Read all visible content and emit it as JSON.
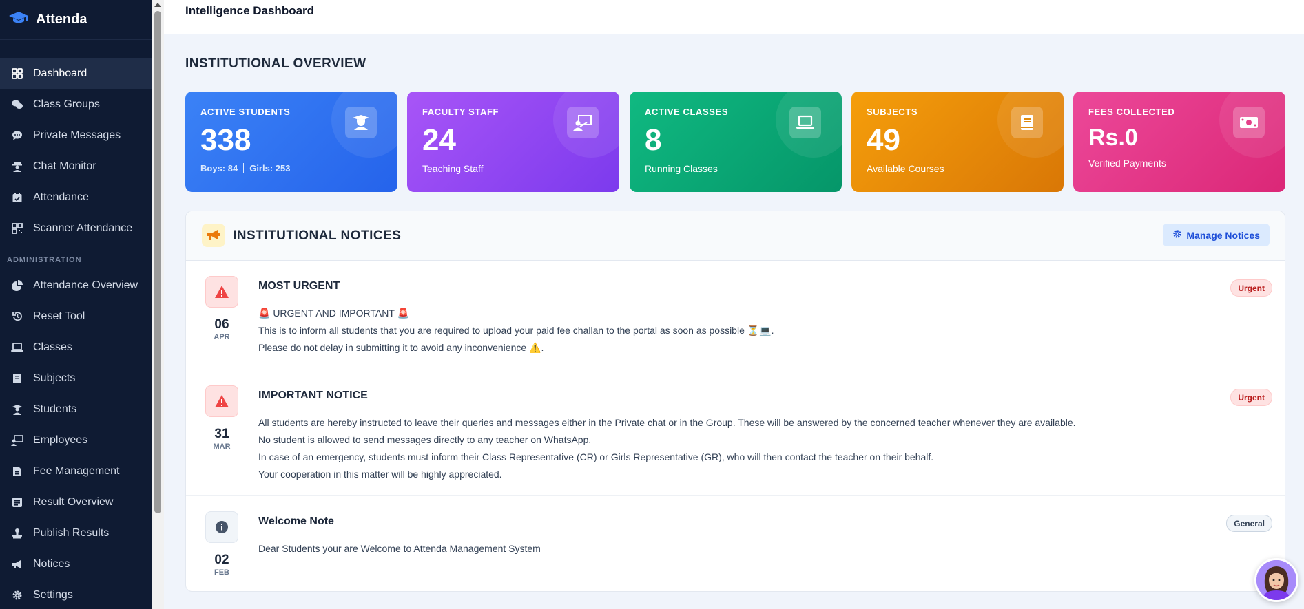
{
  "app": {
    "name": "Attenda"
  },
  "header": {
    "title": "Intelligence Dashboard"
  },
  "sidebar": {
    "items": [
      {
        "label": "Dashboard"
      },
      {
        "label": "Class Groups"
      },
      {
        "label": "Private Messages"
      },
      {
        "label": "Chat Monitor"
      },
      {
        "label": "Attendance"
      },
      {
        "label": "Scanner Attendance"
      }
    ],
    "admin_label": "ADMINISTRATION",
    "admin_items": [
      {
        "label": "Attendance Overview"
      },
      {
        "label": "Reset Tool"
      },
      {
        "label": "Classes"
      },
      {
        "label": "Subjects"
      },
      {
        "label": "Students"
      },
      {
        "label": "Employees"
      },
      {
        "label": "Fee Management"
      },
      {
        "label": "Result Overview"
      },
      {
        "label": "Publish Results"
      },
      {
        "label": "Notices"
      },
      {
        "label": "Settings"
      }
    ]
  },
  "overview": {
    "title": "INSTITUTIONAL OVERVIEW",
    "cards": [
      {
        "label": "ACTIVE STUDENTS",
        "value": "338",
        "boys": "Boys: 84",
        "girls": "Girls: 253",
        "icon": "graduate-icon"
      },
      {
        "label": "FACULTY STAFF",
        "value": "24",
        "sub": "Teaching Staff",
        "icon": "teacher-board-icon"
      },
      {
        "label": "ACTIVE CLASSES",
        "value": "8",
        "sub": "Running Classes",
        "icon": "laptop-icon"
      },
      {
        "label": "SUBJECTS",
        "value": "49",
        "sub": "Available Courses",
        "icon": "book-icon"
      },
      {
        "label": "FEES COLLECTED",
        "value": "Rs.0",
        "sub": "Verified Payments",
        "icon": "money-icon"
      }
    ]
  },
  "notices": {
    "title": "INSTITUTIONAL NOTICES",
    "manage_label": "Manage Notices",
    "items": [
      {
        "day": "06",
        "month": "APR",
        "title": "MOST URGENT",
        "badge": "Urgent",
        "lines": [
          "🚨 URGENT AND IMPORTANT 🚨",
          "This is to inform all students that you are required to upload your paid fee challan to the portal as soon as possible ⏳💻.",
          "Please do not delay in submitting it to avoid any inconvenience ⚠️."
        ]
      },
      {
        "day": "31",
        "month": "MAR",
        "title": "IMPORTANT NOTICE",
        "badge": "Urgent",
        "lines": [
          "All students are hereby instructed to leave their queries and messages either in the Private chat or in the Group. These will be answered by the concerned teacher whenever they are available.",
          "No student is allowed to send messages directly to any teacher on WhatsApp.",
          "In case of an emergency, students must inform their Class Representative (CR) or Girls Representative (GR), who will then contact the teacher on their behalf.",
          "Your cooperation in this matter will be highly appreciated."
        ]
      },
      {
        "day": "02",
        "month": "FEB",
        "title": "Welcome Note",
        "badge": "General",
        "lines": [
          "Dear Students your are Welcome to Attenda Management System"
        ]
      }
    ]
  },
  "colors": {
    "sidebar_bg": "#0f1b33",
    "blue": "#3b82f6",
    "purple": "#a855f7",
    "green": "#10b981",
    "orange": "#f59e0b",
    "pink": "#ec4899",
    "urgent": "#b91c1c"
  }
}
